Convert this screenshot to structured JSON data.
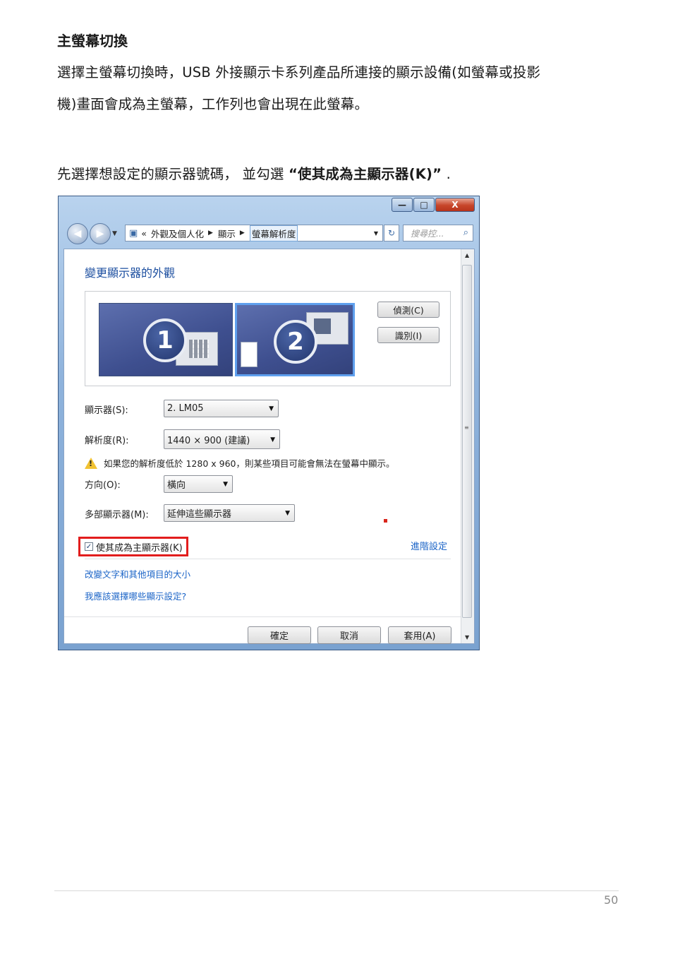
{
  "heading": "主螢幕切換",
  "paragraphs": {
    "line1": "選擇主螢幕切換時，USB 外接顯示卡系列產品所連接的顯示設備(如螢幕或投影",
    "line2": "機)畫面會成為主螢幕，工作列也會出現在此螢幕。",
    "instruction_prefix": "先選擇想設定的顯示器號碼，  並勾選 ",
    "instruction_bold": "“使其成為主顯示器(K)”",
    "instruction_suffix": " ."
  },
  "window": {
    "controls": {
      "minimize": "—",
      "maximize": "□",
      "close": "X"
    },
    "address": {
      "overflow": "«",
      "crumbs": [
        "外觀及個人化",
        "顯示",
        "螢幕解析度"
      ]
    },
    "search_placeholder": "搜尋控...",
    "title": "變更顯示器的外觀",
    "monitors": [
      {
        "number": "1"
      },
      {
        "number": "2"
      }
    ],
    "buttons": {
      "detect": "偵測(C)",
      "identify": "識別(I)"
    },
    "display": {
      "label": "顯示器(S):",
      "value": "2. LM05"
    },
    "resolution": {
      "label": "解析度(R):",
      "value": "1440 × 900 (建議)"
    },
    "warning": "如果您的解析度低於 1280 x 960，則某些項目可能會無法在螢幕中顯示。",
    "orientation": {
      "label": "方向(O):",
      "value": "橫向"
    },
    "multiple": {
      "label": "多部顯示器(M):",
      "value": "延伸這些顯示器"
    },
    "primary_checkbox": {
      "label": "使其成為主顯示器(K)",
      "checked": true
    },
    "advanced_link": "進階設定",
    "links": [
      "改變文字和其他項目的大小",
      "我應該選擇哪些顯示設定?"
    ],
    "footer": {
      "ok": "確定",
      "cancel": "取消",
      "apply": "套用(A)"
    }
  },
  "page_number": "50",
  "colors": {
    "link": "#1b64c7",
    "highlight_box": "#e21d1d",
    "title": "#1d4fa0"
  }
}
